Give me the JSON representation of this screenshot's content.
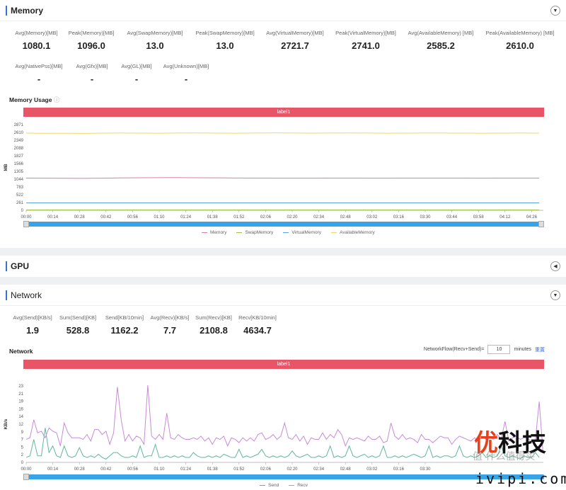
{
  "memory": {
    "title": "Memory",
    "toggle_icon": "chevron-down-icon",
    "stats_row1": [
      {
        "label": "Avg(Memory)[MB]",
        "value": "1080.1"
      },
      {
        "label": "Peak(Memory)[MB]",
        "value": "1096.0"
      },
      {
        "label": "Avg(SwapMemory)[MB]",
        "value": "13.0"
      },
      {
        "label": "Peak(SwapMemory)[MB]",
        "value": "13.0"
      },
      {
        "label": "Avg(VirtualMemory)[MB]",
        "value": "2721.7"
      },
      {
        "label": "Peak(VirtualMemory)[MB]",
        "value": "2741.0"
      },
      {
        "label": "Avg(AvailableMemory) [MB]",
        "value": "2585.2"
      },
      {
        "label": "Peak(AvailableMemory) [MB]",
        "value": "2610.0"
      }
    ],
    "stats_row2": [
      {
        "label": "Avg(NativePss)[MB]",
        "value": "-"
      },
      {
        "label": "Avg(Gfx)[MB]",
        "value": "-"
      },
      {
        "label": "Avg(GL)[MB]",
        "value": "-"
      },
      {
        "label": "Avg(Unknown)[MB]",
        "value": "-"
      }
    ],
    "chart_title": "Memory Usage",
    "help_icon": "question-circle-icon",
    "label_bar": "label1"
  },
  "gpu": {
    "title": "GPU",
    "toggle_icon": "chevron-left-icon"
  },
  "network": {
    "title": "Network",
    "toggle_icon": "chevron-down-icon",
    "stats": [
      {
        "label": "Avg(Send)[KB/s]",
        "value": "1.9"
      },
      {
        "label": "Sum(Send)[KB]",
        "value": "528.8"
      },
      {
        "label": "Send[KB/10min]",
        "value": "1162.2"
      },
      {
        "label": "Avg(Recv)[KB/s]",
        "value": "7.7"
      },
      {
        "label": "Sum(Recv)[KB]",
        "value": "2108.8"
      },
      {
        "label": "Recv[KB/10min]",
        "value": "4634.7"
      }
    ],
    "chart_title": "Network",
    "flow_label": "NetworkFlow(Recv+Send)=",
    "flow_value": "10",
    "flow_unit": "minutes",
    "flow_button": "重置",
    "label_bar": "label1"
  },
  "watermark": {
    "brand": "优科技",
    "sub": "值 什么值得买",
    "url": "ivipi.com"
  },
  "chart_data": [
    {
      "type": "line",
      "ylabel": "MB",
      "ylim": [
        0,
        2871
      ],
      "yticks": [
        "0",
        "261",
        "522",
        "783",
        "1044",
        "1305",
        "1566",
        "1827",
        "2088",
        "2349",
        "2610",
        "2871"
      ],
      "xticks": [
        "00:00",
        "00:14",
        "00:28",
        "00:42",
        "00:56",
        "01:10",
        "01:24",
        "01:38",
        "01:52",
        "02:06",
        "02:20",
        "02:34",
        "02:48",
        "03:02",
        "03:16",
        "03:30",
        "03:44",
        "03:58",
        "04:12",
        "04:26"
      ],
      "x_step_seconds": 10,
      "grid": false,
      "legend": "bottom",
      "series": [
        {
          "name": "Memory",
          "color": "#d77fa8",
          "values": [
            1080,
            1078,
            1075,
            1072,
            1076,
            1085,
            1090,
            1094,
            1096,
            1092,
            1088,
            1083,
            1080,
            1078,
            1077,
            1078,
            1079,
            1080,
            1078,
            1077,
            1079,
            1080,
            1081,
            1079,
            1078,
            1080,
            1081,
            1080
          ]
        },
        {
          "name": "SwapMemory",
          "color": "#9bc53d",
          "values": [
            13,
            13,
            13,
            13,
            13,
            13,
            13,
            13,
            13,
            13,
            13,
            13,
            13,
            13,
            13,
            13,
            13,
            13,
            13,
            13,
            13,
            13,
            13,
            13,
            13,
            13,
            13,
            13
          ]
        },
        {
          "name": "VirtualMemory",
          "color": "#5aa3e0",
          "values": [
            250,
            250,
            250,
            250,
            250,
            250,
            250,
            250,
            250,
            250,
            250,
            250,
            250,
            250,
            250,
            250,
            250,
            250,
            250,
            250,
            250,
            250,
            250,
            250,
            250,
            250,
            250,
            250
          ]
        },
        {
          "name": "AvailableMemory",
          "color": "#f1d46b",
          "values": [
            2585,
            2580,
            2583,
            2578,
            2586,
            2590,
            2585,
            2582,
            2588,
            2592,
            2586,
            2584,
            2590,
            2594,
            2588,
            2585,
            2590,
            2592,
            2588,
            2584,
            2586,
            2590,
            2588,
            2585,
            2583,
            2586,
            2588,
            2585
          ]
        }
      ]
    },
    {
      "type": "line",
      "ylabel": "KB/s",
      "ylim": [
        0,
        23.3
      ],
      "yticks": [
        "0",
        "2",
        "5",
        "7",
        "9",
        "12",
        "14",
        "16",
        "19",
        "21",
        "23"
      ],
      "xticks": [
        "00:00",
        "00:14",
        "00:28",
        "00:42",
        "00:56",
        "01:10",
        "01:24",
        "01:38",
        "01:52",
        "02:06",
        "02:20",
        "02:34",
        "02:48",
        "03:02",
        "03:16",
        "03:30"
      ],
      "x_step_seconds": 2,
      "grid": false,
      "legend": "bottom",
      "series": [
        {
          "name": "Send",
          "color": "#5fb89a",
          "values": [
            1.5,
            2,
            7,
            2,
            2,
            10.5,
            3,
            5,
            2,
            1.5,
            5,
            2,
            1.5,
            2,
            4.5,
            2,
            1.5,
            2,
            1.5,
            2.5,
            1.5,
            1,
            2,
            3,
            3,
            2,
            1.5,
            1.5,
            2,
            1.5,
            5,
            1.5,
            2,
            2,
            5.5,
            1.5,
            1.5,
            2,
            1.5,
            2,
            1.5,
            2,
            1.5,
            1.5,
            3,
            2,
            1.5,
            1.5,
            2,
            1.5,
            2,
            1.5,
            2.5,
            2,
            1.5,
            1.5,
            4,
            1.5,
            2,
            1.5,
            2,
            2.5,
            4,
            2,
            1.5,
            2,
            1.5,
            2,
            1.5,
            2,
            3.5,
            2,
            1.5,
            2,
            2.5,
            1.5,
            1.5,
            2,
            1.5,
            2,
            5,
            1.5,
            2,
            1.5,
            2,
            5,
            2,
            1.5,
            2,
            2.5,
            1.5,
            2,
            1.5,
            2,
            5,
            1.5,
            1.5,
            2,
            1.5,
            2,
            1.5,
            2,
            2.5,
            2,
            1.5,
            2,
            5,
            1.5,
            2,
            1.5,
            2,
            2,
            1.5,
            2,
            5,
            2,
            1.5,
            2,
            1.5,
            2,
            3,
            1.5,
            2,
            1.5,
            2,
            5,
            2,
            1.5,
            2,
            1.5,
            1,
            2,
            1.5,
            1.5,
            3,
            1.5
          ]
        },
        {
          "name": "Recv",
          "color": "#c88ad8",
          "values": [
            7,
            7.5,
            13,
            9,
            9.5,
            7.5,
            10.5,
            9.5,
            9,
            5,
            12,
            9,
            7.5,
            7.5,
            7.5,
            7,
            8.5,
            6.5,
            10,
            10,
            8.5,
            9.5,
            5.5,
            9,
            23,
            13,
            6.5,
            8.5,
            6.5,
            8,
            7.5,
            5.5,
            23.5,
            8,
            7,
            8.5,
            7,
            15,
            7.5,
            7,
            8.5,
            7.5,
            7,
            7,
            7.5,
            7,
            8,
            6.5,
            7.5,
            5.5,
            7.5,
            7,
            8,
            5,
            7.5,
            7,
            6,
            7.5,
            6.5,
            7.5,
            6.5,
            8.5,
            9,
            7,
            7.5,
            8.5,
            7,
            8,
            12,
            7.5,
            7,
            8.5,
            6.5,
            8,
            5.5,
            7.5,
            7,
            7,
            9,
            7,
            8.5,
            7.5,
            10,
            8.5,
            5,
            7.5,
            7,
            7.5,
            7,
            6.5,
            8,
            7,
            7,
            8,
            6,
            6.5,
            12,
            8,
            7,
            8.5,
            7,
            7.5,
            7,
            6,
            8.5,
            7,
            7,
            6,
            7,
            8,
            7.5,
            7.5,
            5.5,
            7,
            8,
            7.5,
            7,
            6.5,
            7.5,
            6.5,
            8,
            7,
            7.5,
            7,
            8.5,
            7,
            12.5,
            6.5,
            7.5,
            8,
            7,
            7.5,
            7.5,
            6,
            7,
            18.5,
            3
          ]
        }
      ]
    }
  ]
}
